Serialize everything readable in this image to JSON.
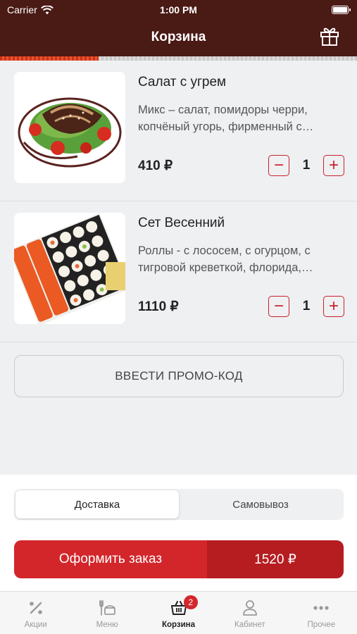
{
  "status_bar": {
    "carrier": "Carrier",
    "time": "1:00 PM"
  },
  "header": {
    "title": "Корзина",
    "gift_icon": "gift-icon"
  },
  "cart": {
    "items": [
      {
        "name": "Салат с угрем",
        "description": "Микс – салат, помидоры черри, копчёный угорь, фирменный с…",
        "price": "410 ₽",
        "quantity": "1"
      },
      {
        "name": "Сет Весенний",
        "description": "Роллы - с лососем, с огурцом, с тигровой креветкой, флорида,…",
        "price": "1110 ₽",
        "quantity": "1"
      }
    ],
    "promo_label": "ВВЕСТИ ПРОМО-КОД"
  },
  "delivery": {
    "options": [
      "Доставка",
      "Самовывоз"
    ],
    "selected": "Доставка"
  },
  "order": {
    "button_label": "Оформить заказ",
    "total": "1520 ₽"
  },
  "tabbar": {
    "items": [
      {
        "label": "Акции",
        "icon": "percent-icon"
      },
      {
        "label": "Меню",
        "icon": "menu-icon"
      },
      {
        "label": "Корзина",
        "icon": "basket-icon",
        "badge": "2",
        "active": true
      },
      {
        "label": "Кабинет",
        "icon": "user-icon"
      },
      {
        "label": "Прочее",
        "icon": "more-icon"
      }
    ]
  },
  "colors": {
    "header": "#4a1a14",
    "accent": "#d3262b",
    "accent_dark": "#b51d21"
  }
}
